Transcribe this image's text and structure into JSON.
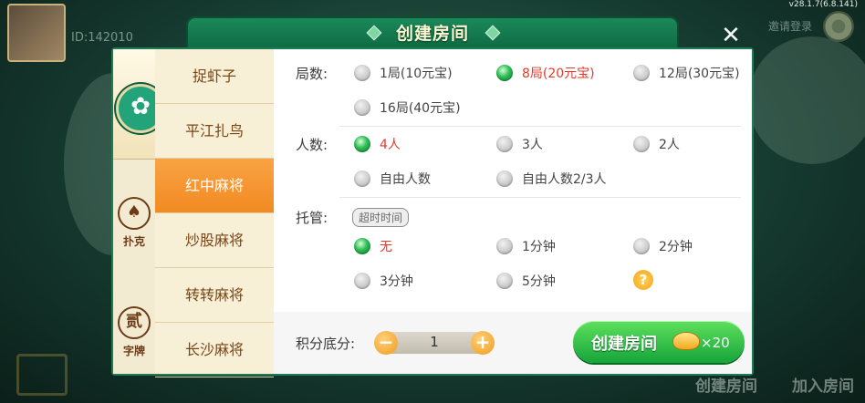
{
  "header": {
    "version": "v28.1.7(6.8.141)",
    "uid": "ID:142010",
    "right_text": "邀请登录"
  },
  "dialog": {
    "title": "创建房间",
    "close_glyph": "✕"
  },
  "side_tabs": [
    {
      "label": "",
      "icon": "mahjong-icon"
    },
    {
      "label": "扑克",
      "glyph": "♠"
    },
    {
      "label": "字牌",
      "glyph": "贰"
    }
  ],
  "games": [
    "捉虾子",
    "平江扎鸟",
    "红中麻将",
    "炒股麻将",
    "转转麻将",
    "长沙麻将"
  ],
  "active_game": "红中麻将",
  "rounds": {
    "label": "局数:",
    "options": [
      "1局(10元宝)",
      "8局(20元宝)",
      "12局(30元宝)",
      "16局(40元宝)"
    ],
    "selected": "8局(20元宝)"
  },
  "players": {
    "label": "人数:",
    "options": [
      "4人",
      "3人",
      "2人",
      "自由人数",
      "自由人数2/3人"
    ],
    "selected": "4人"
  },
  "trustee": {
    "label": "托管:",
    "tag": "超时时间",
    "options": [
      "无",
      "1分钟",
      "2分钟",
      "3分钟",
      "5分钟"
    ],
    "selected": "无",
    "help": "?"
  },
  "score": {
    "label": "积分底分:",
    "value": "1",
    "minus": "−",
    "plus": "+"
  },
  "create": {
    "label": "创建房间",
    "cost": "×20"
  },
  "bottom": {
    "left": "创建房间",
    "right": "加入房间"
  },
  "colors": {
    "frame": "#1d7c53",
    "selected_text": "#e23a2a",
    "active_tab": "#f28a22",
    "create_button": "#16a53a"
  }
}
